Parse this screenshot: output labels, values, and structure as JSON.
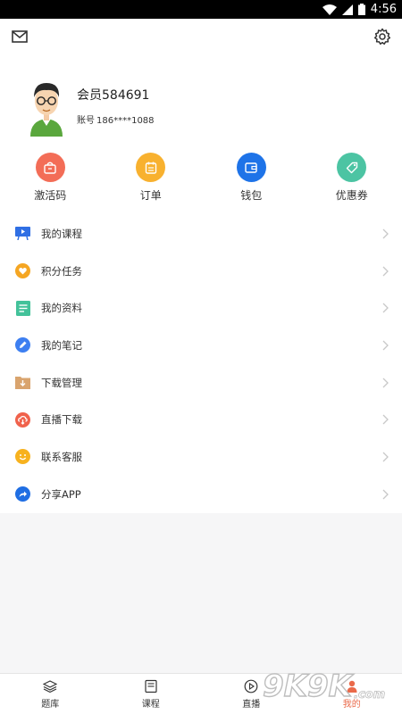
{
  "status": {
    "time": "4:56"
  },
  "header": {
    "mail_icon": "mail-icon",
    "settings_icon": "gear-icon"
  },
  "profile": {
    "name": "会员584691",
    "account_label": "账号",
    "account_value": "186****1088"
  },
  "quick_actions": [
    {
      "label": "激活码",
      "icon": "bag-icon",
      "color": "#f36d57"
    },
    {
      "label": "订单",
      "icon": "calendar-icon",
      "color": "#f8b12f"
    },
    {
      "label": "钱包",
      "icon": "wallet-icon",
      "color": "#1e73e8"
    },
    {
      "label": "优惠券",
      "icon": "tag-icon",
      "color": "#4cc4a3"
    }
  ],
  "menu": [
    {
      "label": "我的课程",
      "icon": "course-icon",
      "color": "#2f6fe4"
    },
    {
      "label": "积分任务",
      "icon": "heart-icon",
      "color": "#f5a623"
    },
    {
      "label": "我的资料",
      "icon": "document-icon",
      "color": "#43c29a"
    },
    {
      "label": "我的笔记",
      "icon": "pencil-icon",
      "color": "#3d7ff1"
    },
    {
      "label": "下载管理",
      "icon": "download-folder-icon",
      "color": "#d9a46e"
    },
    {
      "label": "直播下载",
      "icon": "cloud-download-icon",
      "color": "#f0624c"
    },
    {
      "label": "联系客服",
      "icon": "smile-icon",
      "color": "#f7b21f"
    },
    {
      "label": "分享APP",
      "icon": "share-icon",
      "color": "#1f6ee3"
    }
  ],
  "bottom_nav": [
    {
      "label": "题库",
      "icon": "layers-icon"
    },
    {
      "label": "课程",
      "icon": "book-icon"
    },
    {
      "label": "直播",
      "icon": "play-icon"
    },
    {
      "label": "我的",
      "icon": "person-icon",
      "active": true
    }
  ],
  "watermark": "9K9K.com"
}
